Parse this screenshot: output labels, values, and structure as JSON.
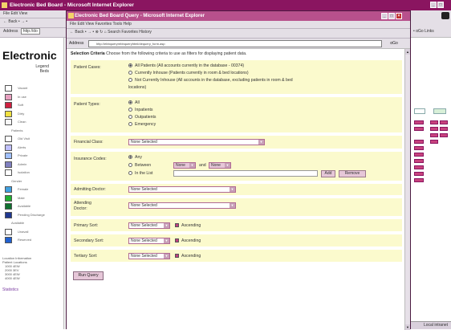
{
  "background_window": {
    "title": "Electronic Bed Board - Microsoft Internet Explorer",
    "menu": "File  Edit  View",
    "nav": "← Back • → •",
    "address_label": "Address",
    "address_short": "http://do",
    "right_toolbar": "• αGo  Links",
    "status_right": "Local intranet"
  },
  "sidebar": {
    "app_title": "Electronic",
    "legend_title": "Legend",
    "legend_sub": "Beds",
    "legend": [
      {
        "label": "Vacant",
        "color": "#ffffff"
      },
      {
        "label": "In use",
        "color": "#e8a0c0"
      },
      {
        "label": "Soft",
        "color": "#d02040"
      },
      {
        "label": "Dirty",
        "color": "#f0e040"
      },
      {
        "label": "Clean",
        "color": "#f8f8f8"
      },
      {
        "label": "Patients",
        "color": ""
      },
      {
        "label": "Old Visit",
        "color": "#ffffff"
      },
      {
        "label": "Alerts",
        "color": "#c0c0ff"
      },
      {
        "label": "Private",
        "color": "#a0c0ff"
      },
      {
        "label": "Admin",
        "color": "#8080c0"
      },
      {
        "label": "Isolation",
        "color": "#ffffff"
      },
      {
        "label": "Gender",
        "color": ""
      },
      {
        "label": "Female",
        "color": "#40a0e0"
      },
      {
        "label": "Male",
        "color": "#20b030"
      },
      {
        "label": "Available",
        "color": "#107030"
      },
      {
        "label": "Pending Discharge",
        "color": "#203890"
      },
      {
        "label": "Available",
        "color": ""
      },
      {
        "label": "Unavail",
        "color": "#ffffff"
      },
      {
        "label": "Reserved",
        "color": "#2060d0"
      }
    ],
    "locations_title": "Location Information",
    "locations_sub": "Patient Locations",
    "location_lines": [
      "1000 4EW",
      "2000 3EV",
      "3000 4EW",
      "4000 4EW"
    ],
    "statistics_link": "Statistics"
  },
  "front_window": {
    "title": "Electronic Bed Board Query - Microsoft Internet Explorer",
    "menu": "File  Edit  View  Favorites  Tools  Help",
    "nav": "← Back •  → •  ⊗  ↻  ⌂   Search   Favorites   History",
    "address_label": "Address",
    "address_url": "http://ebbqueryrebbqueryhtml/dequery_form.asp",
    "go_label": "αGo"
  },
  "form": {
    "intro_bold": "Selection Criteria",
    "intro_text": "Choose from the following criteria to use as filters for displaying patient data.",
    "patient_cases": {
      "label": "Patient Cases:",
      "options": [
        {
          "text": "All Patients (All accounts currently in the database - 00374)",
          "selected": true
        },
        {
          "text": "Currently Inhouse (Patients currently in room & bed locations)",
          "selected": false
        },
        {
          "text": "Not Currently Inhouse (All accounts in the database, excluding patients in room & bed",
          "selected": false
        }
      ],
      "wrap": "locations)"
    },
    "patient_types": {
      "label": "Patient Types:",
      "options": [
        {
          "text": "All",
          "selected": true
        },
        {
          "text": "Inpatients",
          "selected": false
        },
        {
          "text": "Outpatients",
          "selected": false
        },
        {
          "text": "Emergency",
          "selected": false
        }
      ]
    },
    "financial_class": {
      "label": "Financial Class:",
      "value": "None Selected"
    },
    "insurance_codes": {
      "label": "Insurance Codes:",
      "any": "Any",
      "between": "Between",
      "between_from": "None",
      "between_and": "and",
      "between_to": "None",
      "in_list": "In the List",
      "list_button_1": "Add",
      "list_button_2": "Remove"
    },
    "admitting_doctor": {
      "label": "Admitting Doctor:",
      "value": "None Selected"
    },
    "attending_doctor": {
      "label": "Attending",
      "label2": "Doctor:",
      "value": "None Selected"
    },
    "primary_sort": {
      "label": "Primary Sort:",
      "value": "None Selected",
      "checkbox": "Ascending",
      "checked": true
    },
    "secondary_sort": {
      "label": "Secondary Sort:",
      "value": "None Selected",
      "checkbox": "Ascending",
      "checked": true
    },
    "tertiary_sort": {
      "label": "Tertiary Sort:",
      "value": "None Selected",
      "checkbox": "Ascending",
      "checked": true
    },
    "run_query": "Run Query"
  }
}
